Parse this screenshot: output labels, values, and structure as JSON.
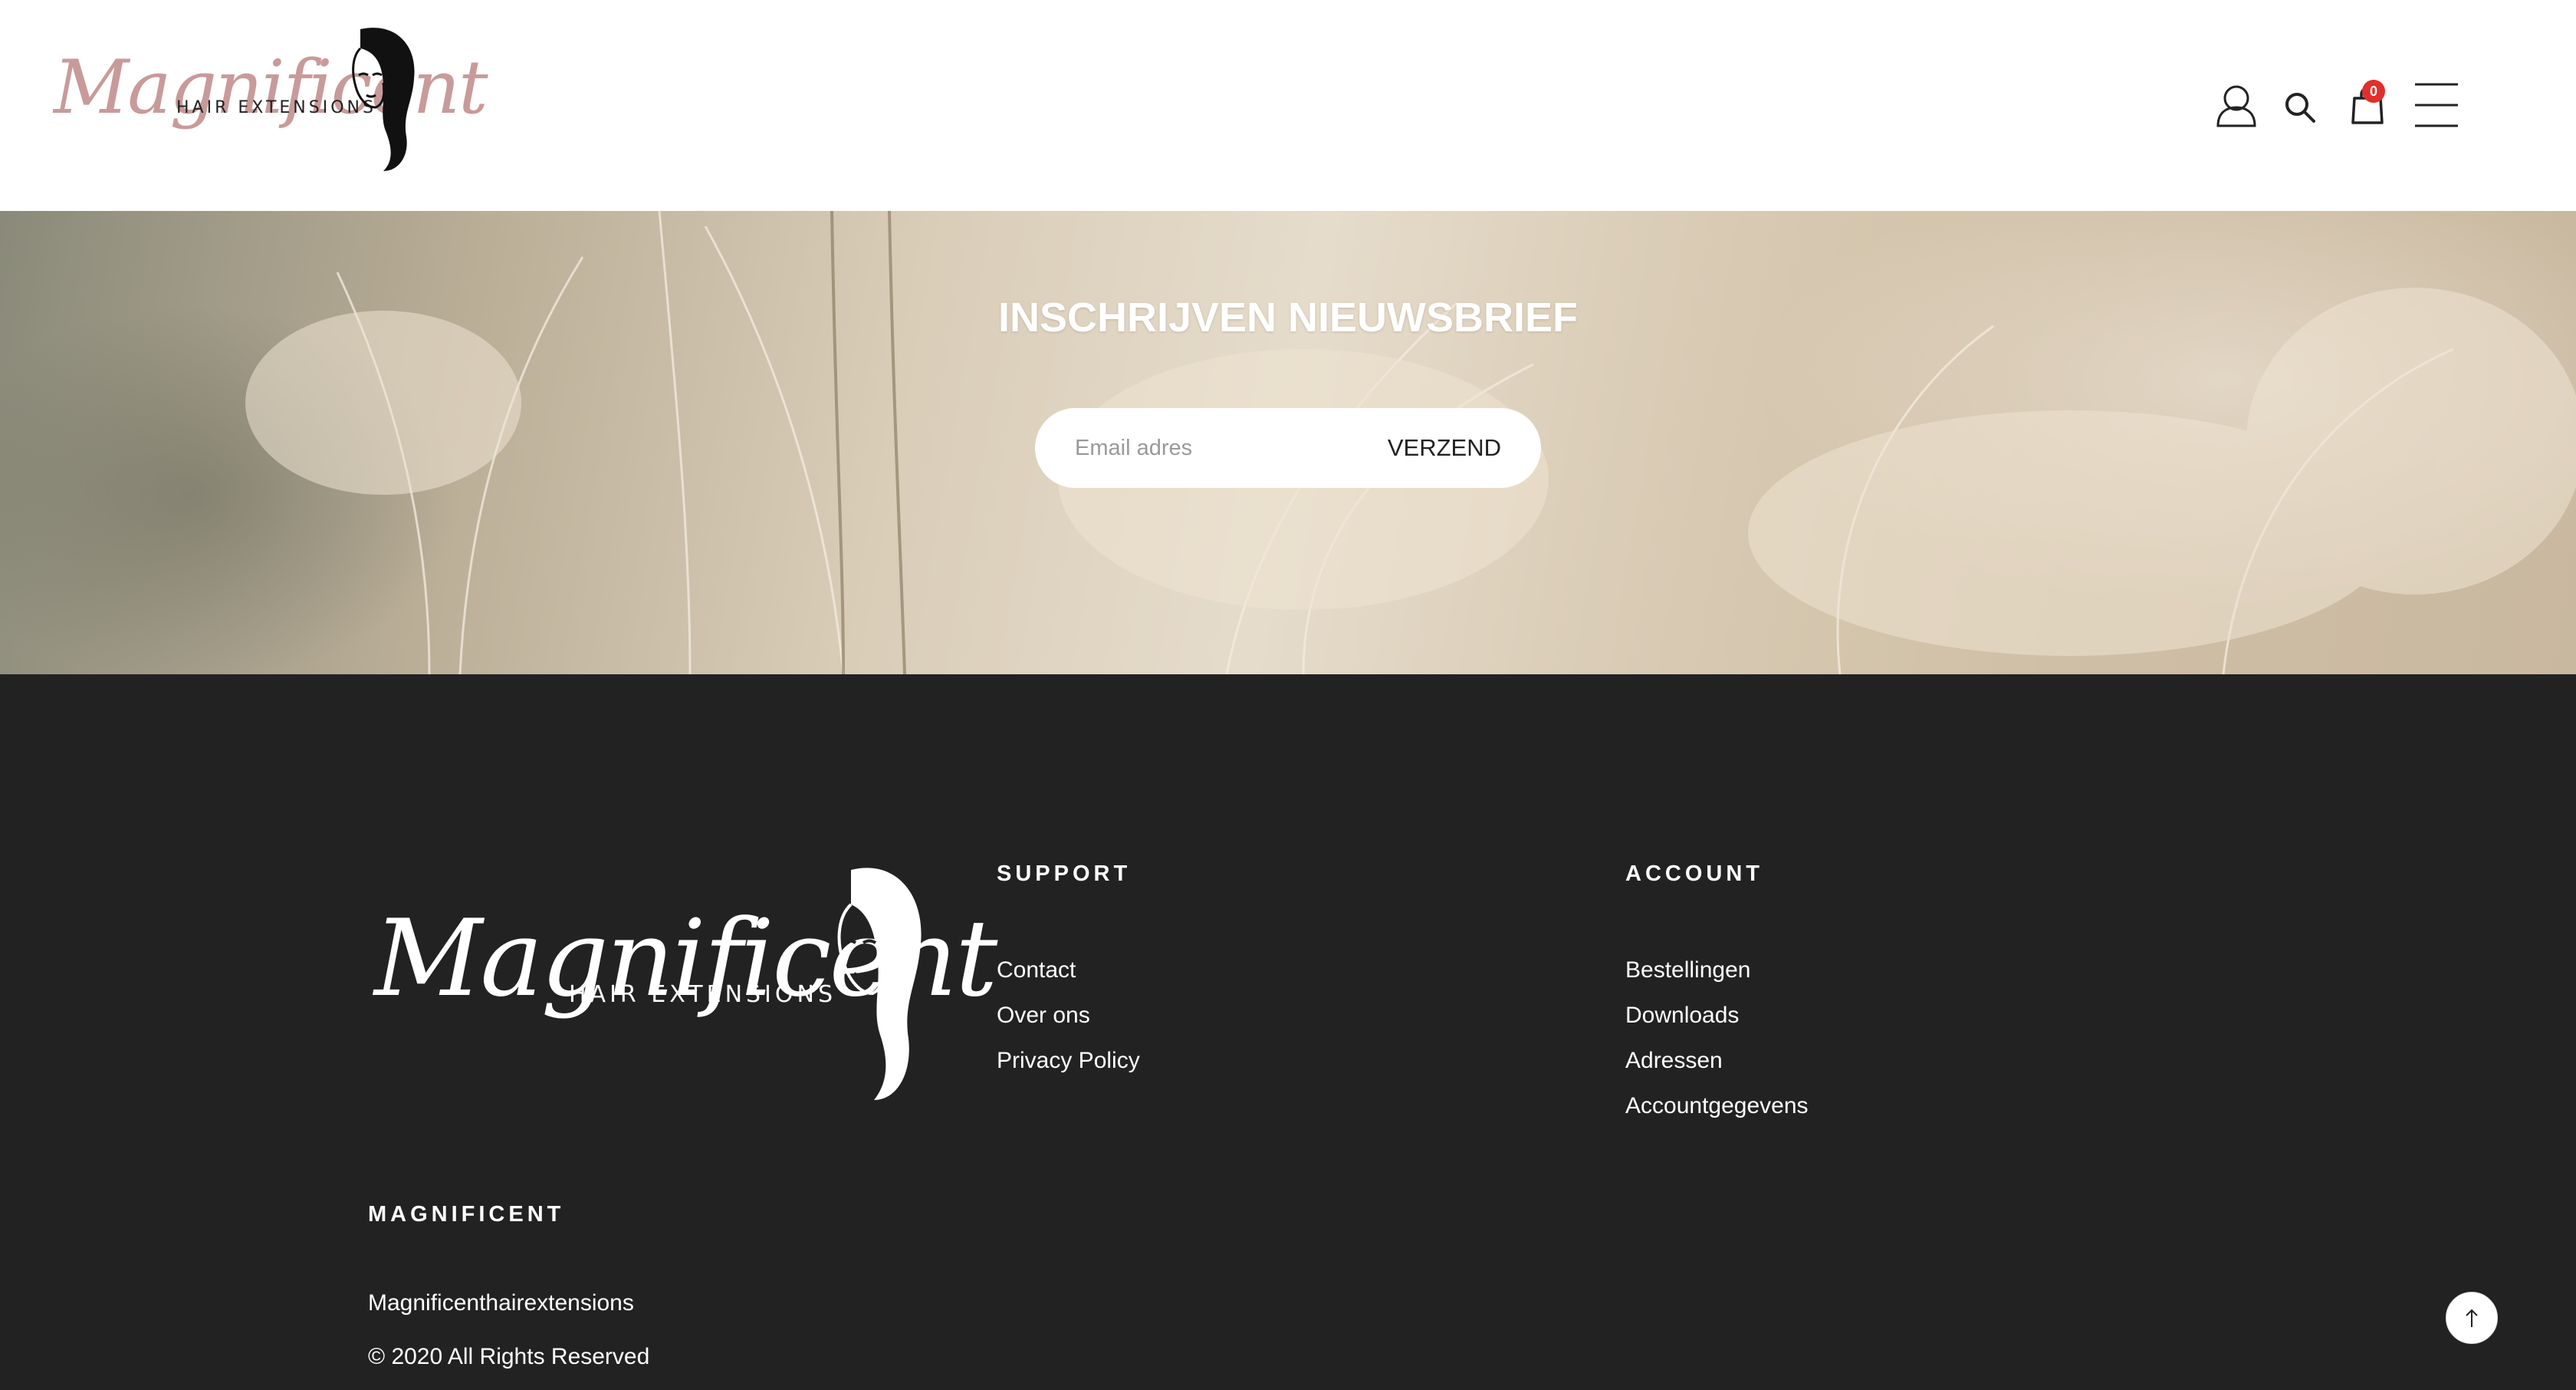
{
  "header": {
    "logo": {
      "script": "Magnificent",
      "sub": "HAIR EXTENSIONS"
    },
    "cart_count": "0",
    "icons": [
      "user-icon",
      "search-icon",
      "shopping-bag-icon",
      "hamburger-menu-icon"
    ]
  },
  "newsletter": {
    "title": "INSCHRIJVEN NIEUWSBRIEF",
    "email_placeholder": "Email adres",
    "submit_label": "VERZEND"
  },
  "footer": {
    "logo": {
      "script": "Magnificent",
      "sub": "HAIR EXTENSIONS"
    },
    "support": {
      "heading": "SUPPORT",
      "links": [
        "Contact",
        "Over ons",
        "Privacy Policy"
      ]
    },
    "account": {
      "heading": "ACCOUNT",
      "links": [
        "Bestellingen",
        "Downloads",
        "Adressen",
        "Accountgegevens"
      ]
    },
    "magnificent": {
      "heading": "MAGNIFICENT",
      "site_name": "Magnificenthairextensions",
      "copyright": "© 2020 All Rights Reserved"
    }
  },
  "colors": {
    "footer_bg": "#222222",
    "accent_pink": "#c99a9a",
    "badge_red": "#e0302c"
  }
}
